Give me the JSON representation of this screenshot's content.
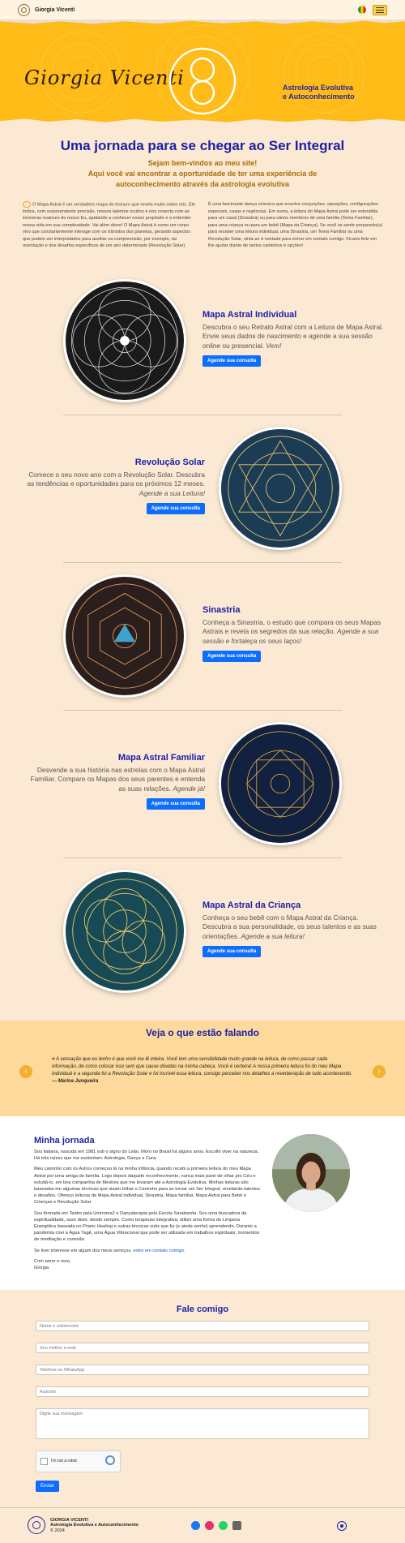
{
  "nav": {
    "brand": "Giorgia Vicenti"
  },
  "hero": {
    "signature": "Giorgia Vicenti",
    "tagline_line1": "Astrologia Evolutiva",
    "tagline_line2": "e Autoconhecimento"
  },
  "intro": {
    "title": "Uma jornada para se chegar ao Ser Integral",
    "welcome": "Sejam bem-vindos ao meu site!",
    "line2": "Aqui você vai encontrar a oportunidade de ter uma experiência de",
    "line3": "autoconhecimento através da astrologia evolutiva",
    "col1": "O Mapa Astral é um verdadeiro mapa do tesouro que revela muito sobre nós. Ele indica, com surpreendente precisão, nossos talentos ocultos e nos conecta com as inúmeras nuances do nosso Eu, ajudando a conhecer nosso propósito e a entender nossa vida em sua complexidade. Vai além disso! O Mapa Astral é como um corpo vivo que constantemente interage com os trânsitos dos planetas, gerando aspectos que podem ser interpretados para auxiliar na compreensão, por exemplo, da orientação e dos desafios específicos de um ano determinado (Revolução Solar).",
    "col2": "É uma fascinante dança cósmica que envolve conjunções, oposições, configurações especiais, casas e regências. Em suma, a leitura do Mapa Astral pode ser estendida para um casal (Sinastria) ou para vários membros de uma família (Tema Familiar), para uma criança ou para um bebê (Mapa da Criança). Se você se sentir preparado(a) para receber uma leitura individual, uma Sinastria, um Tema Familiar ou uma Revolução Solar, sinta-se à vontade para entrar em contato comigo. Ficarei feliz em lhe ajudar diante de tantos caminhos e opções!"
  },
  "services": [
    {
      "title": "Mapa Astral Individual",
      "text": "Descubra o seu Retrato Astral com a Leitura de Mapa Astral. Envie seus dados de nascimento e agende a sua sessão online ou presencial.",
      "em": "Vem!",
      "button": "Agende sua consulta"
    },
    {
      "title": "Revolução Solar",
      "text": "Comece o seu novo ano com a Revolução Solar. Descubra as tendências e oportunidades para os próximos 12 meses.",
      "em": "Agende a sua Leitura!",
      "button": "Agende sua consulta"
    },
    {
      "title": "Sinastria",
      "text": "Conheça a Sinastria, o estudo que compara os seus Mapas Astrais e revela os segredos da sua relação.",
      "em": "Agende a sua sessão e fortaleça os seus laços!",
      "button": "Agende sua consulta"
    },
    {
      "title": "Mapa Astral Familiar",
      "text": "Desvende a sua história nas estrelas com o Mapa Astral Familiar. Compare os Mapas dos seus parentes e entenda as suas relações.",
      "em": "Agende já!",
      "button": "Agende sua consulta"
    },
    {
      "title": "Mapa Astral da Criança",
      "text": "Conheça o seu bebê com o Mapa Astral da Criança. Descubra a sua personalidade, os seus talentos e as suas orientações.",
      "em": "Agende a sua leitura!",
      "button": "Agende sua consulta"
    }
  ],
  "testimonials": {
    "title": "Veja o que estão falando",
    "quote": "A sensação que eu tenho é que você me lê inteira. Você tem uma sensibilidade muito grande na leitura, de como passar cada informação, de como colocar isso sem que cause dúvidas na minha cabeça. Você é certeira! A nossa primeira leitura foi do meu Mapa individual e a segunda foi a Revolução Solar e foi incrível essa leitura, consigo perceber nos detalhes a reverberação de tudo acontecendo.",
    "author": "— Marina Junqueira"
  },
  "about": {
    "title": "Minha jornada",
    "p1": "Sou italiana, nascida em 1981 sob o signo do Leão. Moro no Brasil há alguns anos. Escolhi viver na natureza. Há três raízes que me sustentam: Astrologia, Dança e Cura.",
    "p2": "Meu caminho com os Astros começou lá na minha infância, quando recebi a primeira leitura do meu Mapa Astral por uma amiga de família. Logo depois daquele reconhecimento, nunca mais parei de olhar pro Céu e estudá-lo, em boa companhia de Mestres que me levaram até a Astrologia Evolutiva. Minhas leituras são baseadas em algumas técnicas que visam trilhar o Caminho para se tornar um Ser Integral, revelando talentos e desafios. Ofereço leituras de Mapa Astral individual, Sinastria, Mapa familiar, Mapa Astral para Bebê e Crianças e Revolução Solar.",
    "p3": "Sou formada em Teatro pela Unirroma2 e Dançaterapia pela Escola Sarabanda. Sou uma buscadora da espiritualidade, ouso dizer, desde sempre. Como terapeuta integrativa, utilizo uma forma de Limpeza Energética baseada no Pranic Healing e outras técnicas sutis que fui (e ainda venho) aprendendo. Durante a pandemia criei a Água Yagê, uma Água Vibracional que pode ser utilizada em trabalhos espirituais, momentos de meditação e conexão.",
    "p4": "Se tiver interesse em algum dos meus serviços,",
    "link": "entre em contato comigo.",
    "sign1": "Com amor e rezo,",
    "sign2": "Giorgia"
  },
  "contact": {
    "title": "Fale comigo",
    "name_ph": "Nome e sobrenome",
    "email_ph": "Seu melhor e-mail",
    "phone_ph": "Telefone ou WhatsApp",
    "subject_ph": "Assunto",
    "message_ph": "Digite sua mensagem",
    "captcha": "I'm not a robot",
    "send": "Enviar"
  },
  "footer": {
    "name": "GIORGIA VICENTI",
    "tagline": "Astrologia Evolutiva e Autoconhecimento",
    "copy": "© 2024"
  },
  "colors": {
    "accent": "#1c1fa8",
    "hero": "#ffbb18",
    "button": "#0d6efd",
    "bg": "#fbe9d3"
  }
}
